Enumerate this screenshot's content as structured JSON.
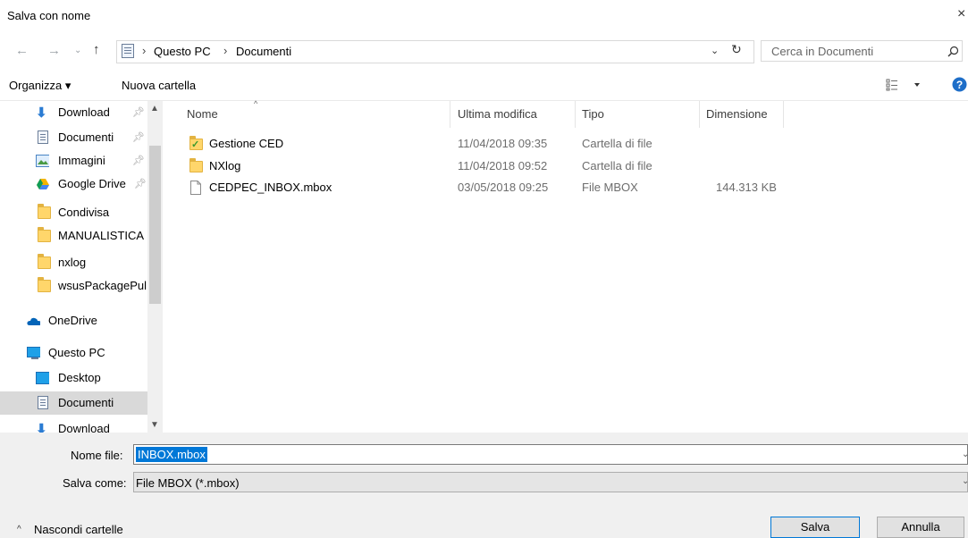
{
  "window": {
    "title": "Salva con nome",
    "close_glyph": "×"
  },
  "address": {
    "breadcrumb": [
      "Questo PC",
      "Documenti"
    ],
    "separator": "›",
    "search_placeholder": "Cerca in Documenti"
  },
  "toolbar": {
    "organize_label": "Organizza ▾",
    "new_folder_label": "Nuova cartella"
  },
  "nav": {
    "items": [
      {
        "label": "Download",
        "icon": "download-icon",
        "pinned": true
      },
      {
        "label": "Documenti",
        "icon": "document-icon",
        "pinned": true
      },
      {
        "label": "Immagini",
        "icon": "pictures-icon",
        "pinned": true
      },
      {
        "label": "Google Drive",
        "icon": "google-drive-icon",
        "pinned": true
      },
      {
        "label": "Condivisa",
        "icon": "folder-icon"
      },
      {
        "label": "MANUALISTICA",
        "icon": "folder-icon"
      },
      {
        "label": "nxlog",
        "icon": "folder-icon"
      },
      {
        "label": "wsusPackagePul",
        "icon": "folder-icon"
      },
      {
        "label": "OneDrive",
        "icon": "onedrive-icon"
      },
      {
        "label": "Questo PC",
        "icon": "computer-icon"
      },
      {
        "label": "Desktop",
        "icon": "desktop-icon"
      },
      {
        "label": "Documenti",
        "icon": "document-icon",
        "selected": true
      },
      {
        "label": "Download",
        "icon": "download-icon"
      }
    ]
  },
  "files": {
    "columns": [
      "Nome",
      "Ultima modifica",
      "Tipo",
      "Dimensione"
    ],
    "rows": [
      {
        "name": "Gestione CED",
        "modified": "11/04/2018 09:35",
        "type": "Cartella di file",
        "size": "",
        "icon": "synced-folder-icon"
      },
      {
        "name": "NXlog",
        "modified": "11/04/2018 09:52",
        "type": "Cartella di file",
        "size": "",
        "icon": "folder-icon"
      },
      {
        "name": "CEDPEC_INBOX.mbox",
        "modified": "03/05/2018 09:25",
        "type": "File MBOX",
        "size": "144.313 KB",
        "icon": "file-icon"
      }
    ]
  },
  "form": {
    "filename_label": "Nome file:",
    "filename_value": "INBOX.mbox",
    "type_label": "Salva come:",
    "type_value": "File MBOX (*.mbox)",
    "hide_folders_label": "Nascondi cartelle",
    "save_label": "Salva",
    "cancel_label": "Annulla"
  },
  "colors": {
    "accent": "#0078d7",
    "selection": "#cce8ff",
    "folder": "#ffd66b"
  }
}
